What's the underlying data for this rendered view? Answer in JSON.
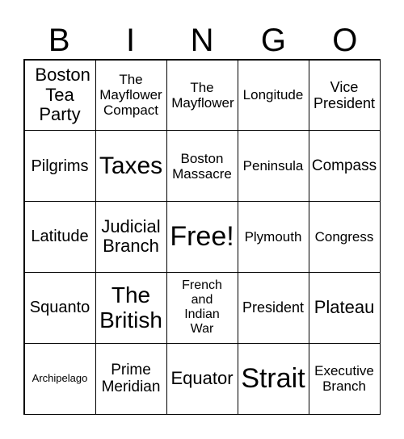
{
  "header": [
    "B",
    "I",
    "N",
    "G",
    "O"
  ],
  "cells": [
    "Boston Tea Party",
    "The Mayflower Compact",
    "The Mayflower",
    "Longitude",
    "Vice President",
    "Pilgrims",
    "Taxes",
    "Boston Massacre",
    "Peninsula",
    "Compass",
    "Latitude",
    "Judicial Branch",
    "Free!",
    "Plymouth",
    "Congress",
    "Squanto",
    "The British",
    "French and Indian War",
    "President",
    "Plateau",
    "Archipelago",
    "Prime Meridian",
    "Equator",
    "Strait",
    "Executive Branch"
  ]
}
